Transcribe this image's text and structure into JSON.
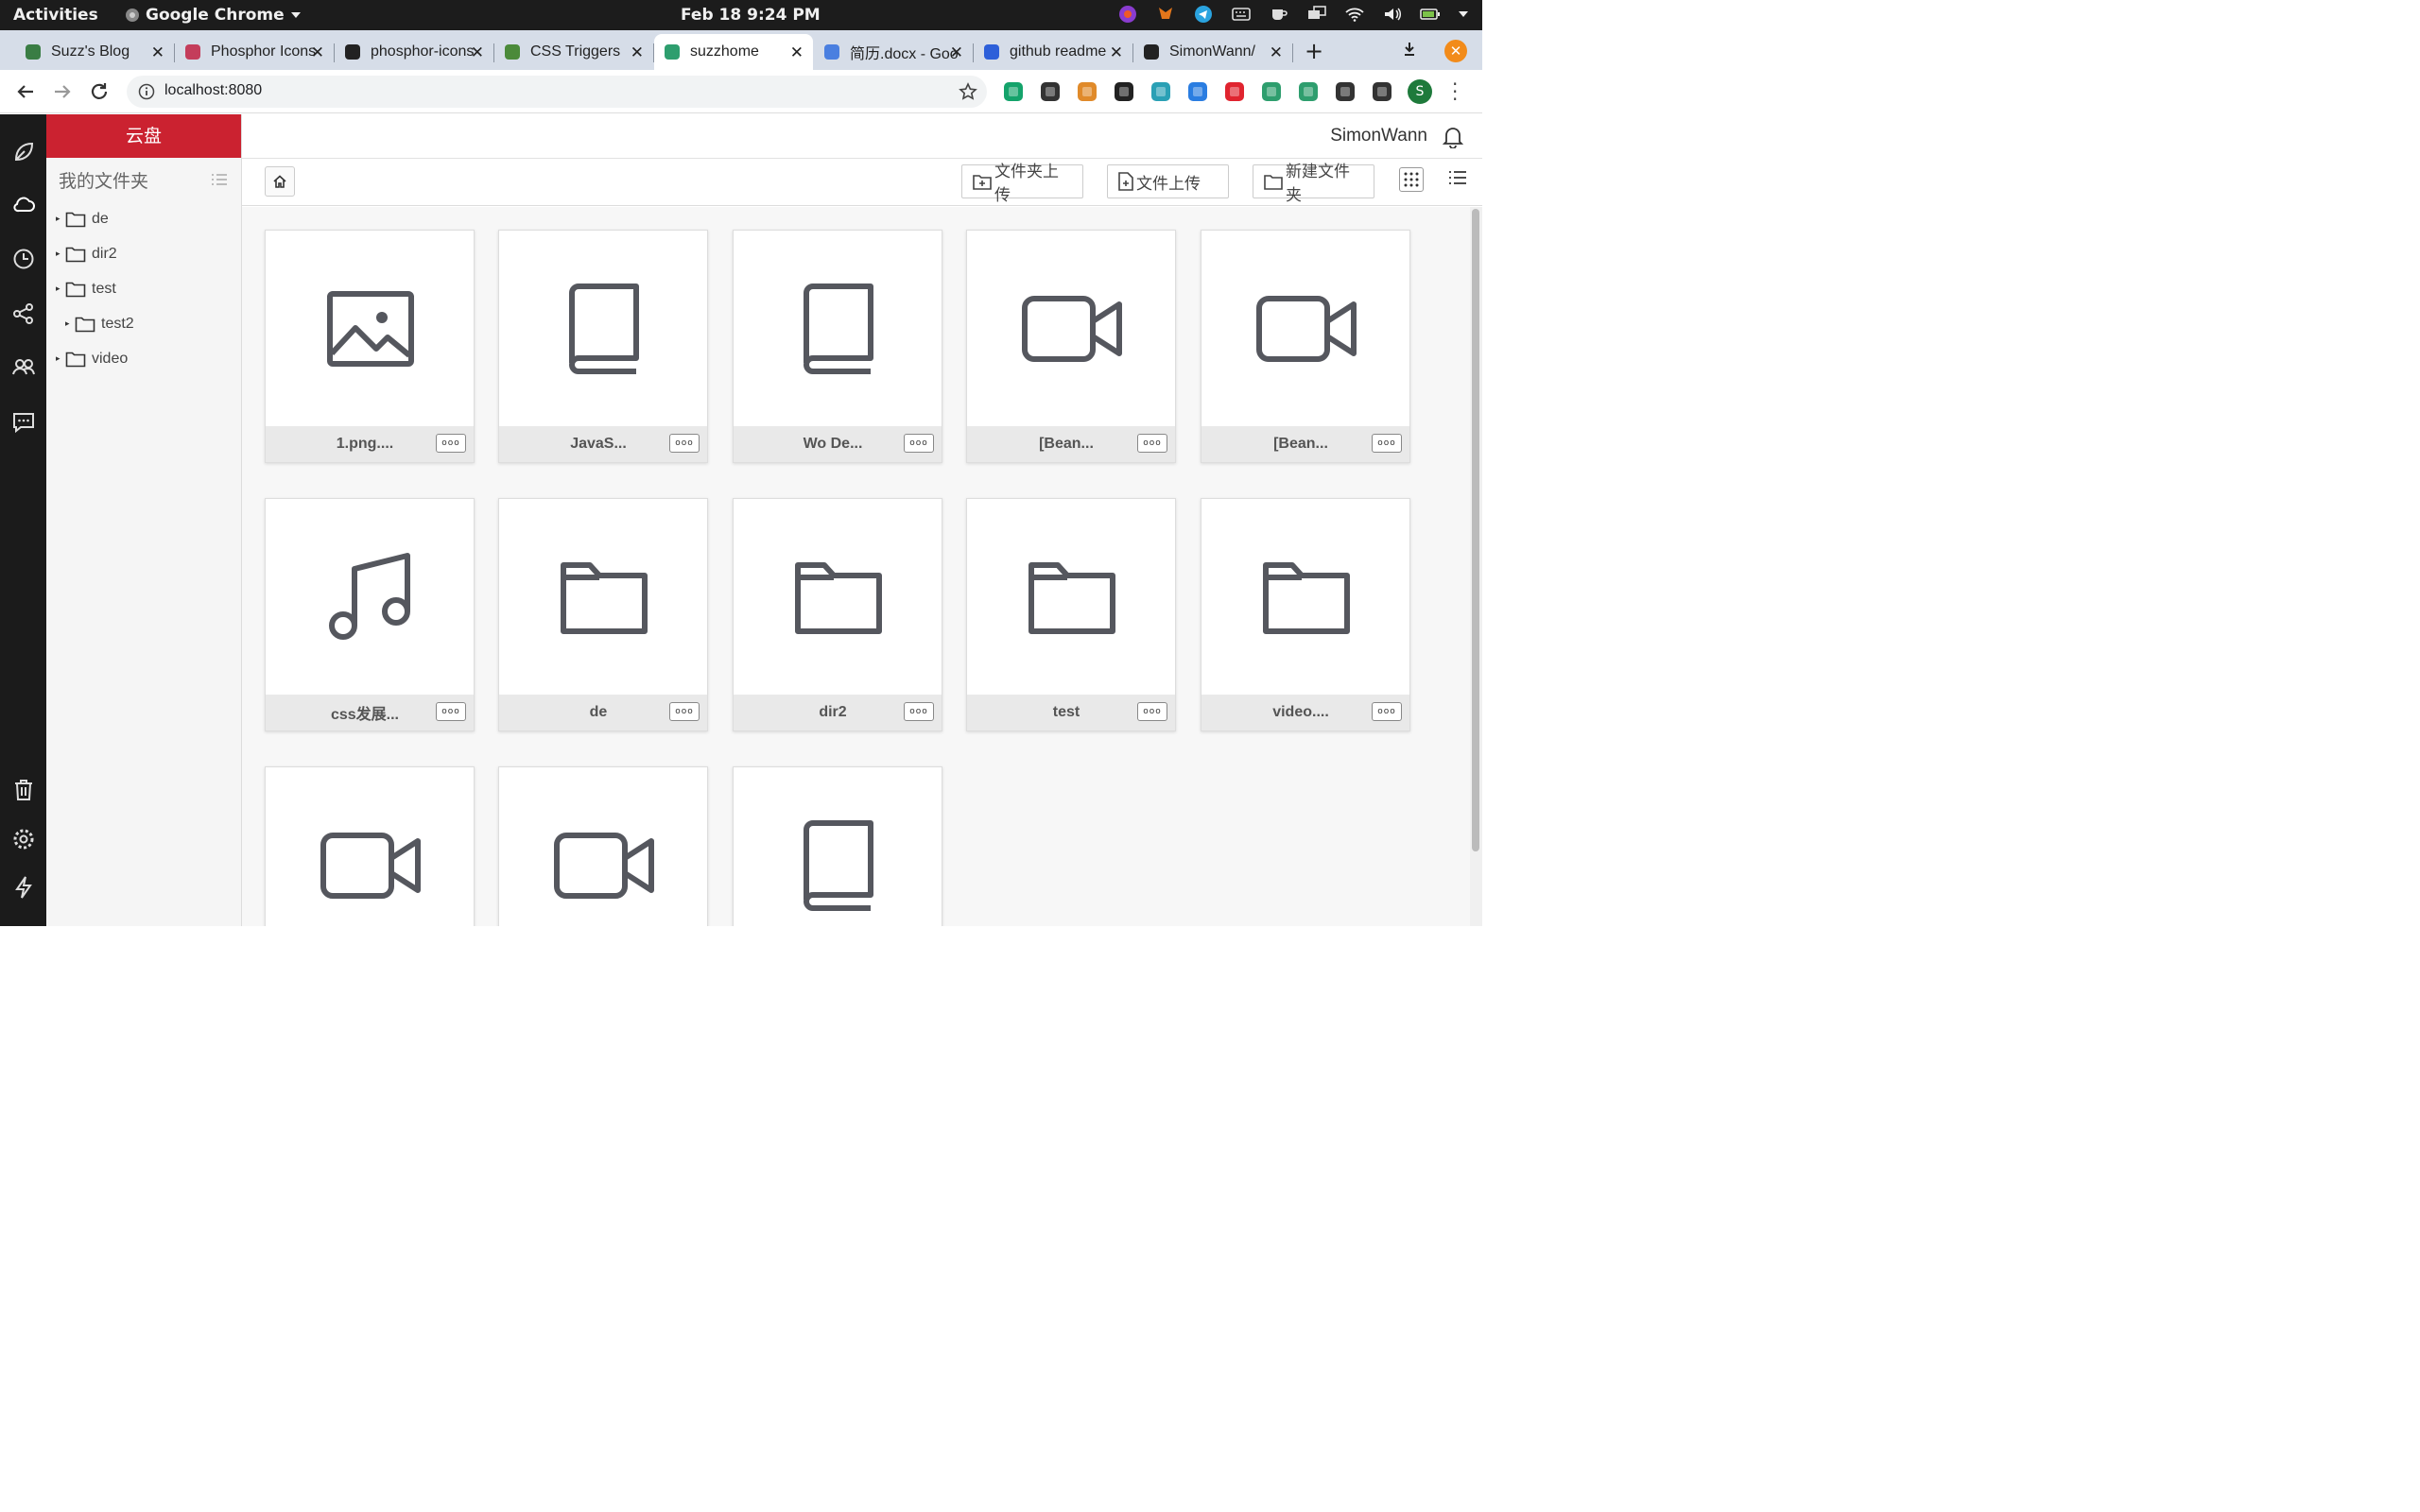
{
  "os": {
    "activities": "Activities",
    "app_name": "Google Chrome",
    "datetime": "Feb 18  9:24 PM"
  },
  "tabs": [
    {
      "label": "Suzz's Blog",
      "icon": "blog-favicon",
      "color": "#3a7d44"
    },
    {
      "label": "Phosphor Icons",
      "icon": "phosphor-favicon",
      "color": "#c43d5b"
    },
    {
      "label": "phosphor-icons",
      "icon": "github-favicon",
      "color": "#222222"
    },
    {
      "label": "CSS Triggers",
      "icon": "css-triggers-favicon",
      "color": "#4b8a3a"
    },
    {
      "label": "suzzhome",
      "icon": "vue-favicon",
      "color": "#2e9e6e",
      "active": true
    },
    {
      "label": "简历.docx - Google",
      "icon": "docs-favicon",
      "color": "#4a7fe0"
    },
    {
      "label": "github readme",
      "icon": "baidu-favicon",
      "color": "#2d5fd9"
    },
    {
      "label": "SimonWann/",
      "icon": "github-favicon",
      "color": "#222222"
    }
  ],
  "browser": {
    "url": "localhost:8080",
    "extensions": [
      {
        "name": "ext-pocket",
        "color": "#14a36b"
      },
      {
        "name": "ext-rocket",
        "color": "#333333"
      },
      {
        "name": "ext-globe",
        "color": "#e08a2a"
      },
      {
        "name": "ext-dark",
        "color": "#222222"
      },
      {
        "name": "ext-notion",
        "color": "#2aa0b5"
      },
      {
        "name": "ext-eyedropper",
        "color": "#2a7de1"
      },
      {
        "name": "ext-m",
        "color": "#e0242f"
      },
      {
        "name": "ext-vue-1",
        "color": "#2e9e6e"
      },
      {
        "name": "ext-vue-2",
        "color": "#2e9e6e"
      },
      {
        "name": "ext-puzzle",
        "color": "#333333"
      },
      {
        "name": "ext-media",
        "color": "#333333"
      }
    ],
    "avatar_letter": "S"
  },
  "sidebar": {
    "header": "云盘",
    "title": "我的文件夹",
    "tree": [
      {
        "label": "de",
        "indent": 0
      },
      {
        "label": "dir2",
        "indent": 0
      },
      {
        "label": "test",
        "indent": 0
      },
      {
        "label": "test2",
        "indent": 1
      },
      {
        "label": "video",
        "indent": 0
      }
    ]
  },
  "header": {
    "username": "SimonWann"
  },
  "toolbar": {
    "upload_folder": "文件夹上传",
    "upload_file": "文件上传",
    "new_folder": "新建文件夹"
  },
  "files": [
    {
      "name": "1.png....",
      "type": "image"
    },
    {
      "name": "JavaS...",
      "type": "book"
    },
    {
      "name": "Wo De...",
      "type": "book"
    },
    {
      "name": "[Bean...",
      "type": "video"
    },
    {
      "name": "[Bean...",
      "type": "video"
    },
    {
      "name": "css发展...",
      "type": "music"
    },
    {
      "name": "de",
      "type": "folder"
    },
    {
      "name": "dir2",
      "type": "folder"
    },
    {
      "name": "test",
      "type": "folder"
    },
    {
      "name": "video....",
      "type": "folder"
    },
    {
      "name": "",
      "type": "video"
    },
    {
      "name": "",
      "type": "video"
    },
    {
      "name": "",
      "type": "book"
    }
  ],
  "more_label": "ooo"
}
